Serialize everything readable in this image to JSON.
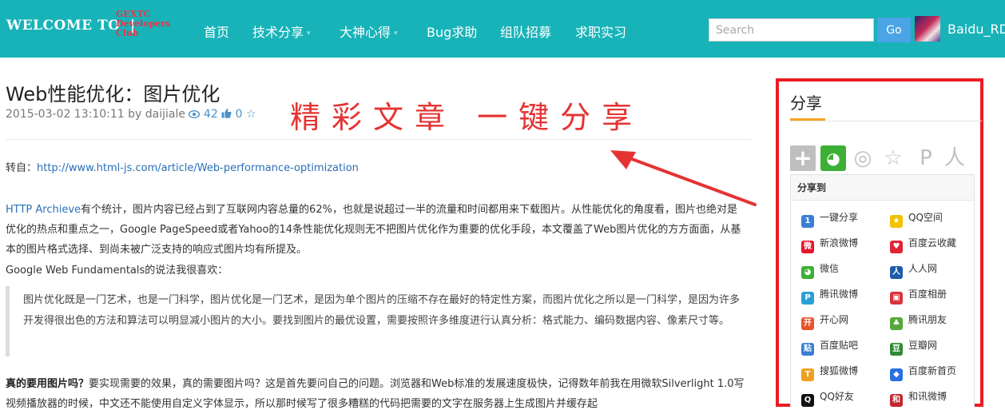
{
  "navbar": {
    "brand": "WELCOME TO",
    "brand_separator": "|",
    "logo_lines": [
      "GEXTC",
      "Developers",
      "Club"
    ],
    "items": [
      {
        "label": "首页",
        "dropdown": false
      },
      {
        "label": "技术分享",
        "dropdown": true
      },
      {
        "label": "大神心得",
        "dropdown": true
      },
      {
        "label": "Bug求助",
        "dropdown": false
      },
      {
        "label": "组队招募",
        "dropdown": false
      },
      {
        "label": "求职实习",
        "dropdown": false
      }
    ],
    "caret_glyph": "▾",
    "search_placeholder": "Search",
    "search_button": "Go",
    "username": "Baidu_RD",
    "avatar_icon": "user-avatar"
  },
  "article": {
    "title": "Web性能优化：图片优化",
    "date": "2015-03-02 13:10:11",
    "by": "by",
    "author": "daijiale",
    "views": "42",
    "likes": "0",
    "headline": "精彩文章 一键分享",
    "source_label": "转自：",
    "source_url": "http://www.html-js.com/article/Web-performance-optimization",
    "archive_link": "HTTP Archieve",
    "archive_text": "有个统计，图片内容已经占到了互联网内容总量的62%，也就是说超过一半的流量和时间都用来下载图片。从性能优化的角度看，图片也绝对是优化的热点和重点之一，Google PageSpeed或者Yahoo的14条性能优化规则无不把图片优化作为重要的优化手段，本文覆盖了Web图片优化的方方面面，从基本的图片格式选择、到尚未被广泛支持的响应式图片均有所提及。",
    "google_text": "Google Web Fundamentals的说法我很喜欢：",
    "quote": "图片优化既是一门艺术，也是一门科学，图片优化是一门艺术，是因为单个图片的压缩不存在最好的特定性方案，而图片优化之所以是一门科学，是因为许多开发得很出色的方法和算法可以明显减小图片的大小。要找到图片的最优设置，需要按照许多维度进行认真分析：格式能力、编码数据内容、像素尺寸等。",
    "need_bold": "真的要用图片吗？",
    "need_text": "要实现需要的效果，真的需要图片吗？这是首先要问自己的问题。浏览器和Web标准的发展速度极快，记得数年前我在用微软Silverlight 1.0写视频播放器的时候，中文还不能使用自定义字体显示，所以那时候写了很多糟糕的代码把需要的文字在服务器上生成图片并缓存起"
  },
  "sidebar": {
    "title": "分享",
    "share_icons": [
      {
        "name": "more-share-icon",
        "glyph": "+"
      },
      {
        "name": "wechat-icon",
        "glyph": "◕"
      },
      {
        "name": "weibo-icon",
        "glyph": "◎"
      },
      {
        "name": "favorite-star-icon",
        "glyph": "☆"
      },
      {
        "name": "pinterest-icon",
        "glyph": "P"
      },
      {
        "name": "renren-icon",
        "glyph": "人"
      }
    ],
    "menu_title": "分享到",
    "menu_items": [
      {
        "label": "一键分享",
        "icon": "one-click-share-icon",
        "color": "#3a7fd5",
        "glyph": "1"
      },
      {
        "label": "QQ空间",
        "icon": "qzone-icon",
        "color": "#f4c100",
        "glyph": "★"
      },
      {
        "label": "新浪微博",
        "icon": "sina-weibo-icon",
        "color": "#e6162d",
        "glyph": "微"
      },
      {
        "label": "百度云收藏",
        "icon": "baidu-favorite-icon",
        "color": "#e02433",
        "glyph": "♥"
      },
      {
        "label": "微信",
        "icon": "wechat-small-icon",
        "color": "#3cb034",
        "glyph": "◕"
      },
      {
        "label": "人人网",
        "icon": "renren-small-icon",
        "color": "#1f5ba8",
        "glyph": "人"
      },
      {
        "label": "腾讯微博",
        "icon": "tencent-weibo-icon",
        "color": "#2a9fd6",
        "glyph": "P"
      },
      {
        "label": "百度相册",
        "icon": "baidu-album-icon",
        "color": "#d8323c",
        "glyph": "▣"
      },
      {
        "label": "开心网",
        "icon": "kaixin-icon",
        "color": "#e8542c",
        "glyph": "开"
      },
      {
        "label": "腾讯朋友",
        "icon": "tencent-pengyou-icon",
        "color": "#54a83a",
        "glyph": "♣"
      },
      {
        "label": "百度贴吧",
        "icon": "baidu-tieba-icon",
        "color": "#3a7fd5",
        "glyph": "贴"
      },
      {
        "label": "豆瓣网",
        "icon": "douban-icon",
        "color": "#2e8b34",
        "glyph": "豆"
      },
      {
        "label": "搜狐微博",
        "icon": "sohu-weibo-icon",
        "color": "#f0a020",
        "glyph": "T"
      },
      {
        "label": "百度新首页",
        "icon": "baidu-home-icon",
        "color": "#2a6fe0",
        "glyph": "◆"
      },
      {
        "label": "QQ好友",
        "icon": "qq-friend-icon",
        "color": "#111111",
        "glyph": "Q"
      },
      {
        "label": "和讯微博",
        "icon": "hexun-weibo-icon",
        "color": "#c2272d",
        "glyph": "和"
      }
    ]
  },
  "colors": {
    "nav_bg": "#17b3b8",
    "link": "#2a6fb8",
    "annotation_red": "#e53333",
    "sidebar_border": "#ea1c24",
    "underline_orange": "#f5a623"
  }
}
